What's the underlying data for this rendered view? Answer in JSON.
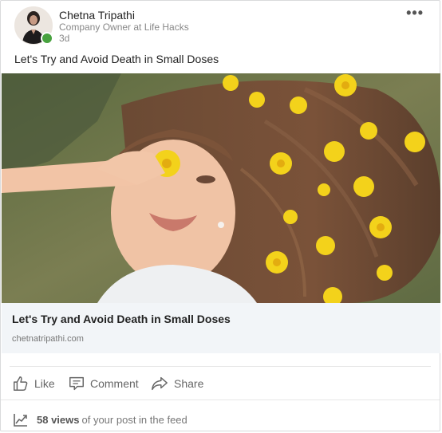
{
  "post": {
    "author": {
      "name": "Chetna Tripathi",
      "headline": "Company Owner at Life Hacks",
      "time": "3d",
      "presence_color": "#48a23f"
    },
    "menu_icon": "more-horizontal-icon",
    "menu_label": "•••",
    "text": "Let's Try and Avoid Death in Small Doses",
    "link": {
      "title": "Let's Try and Avoid Death in Small Doses",
      "domain": "chetnatripathi.com"
    },
    "actions": [
      {
        "label": "Like",
        "icon": "thumbs-up-icon"
      },
      {
        "label": "Comment",
        "icon": "comment-icon"
      },
      {
        "label": "Share",
        "icon": "share-icon"
      }
    ],
    "stats": {
      "icon": "trending-chart-icon",
      "views_count": "58 views",
      "views_text": "of your post in the feed"
    }
  }
}
